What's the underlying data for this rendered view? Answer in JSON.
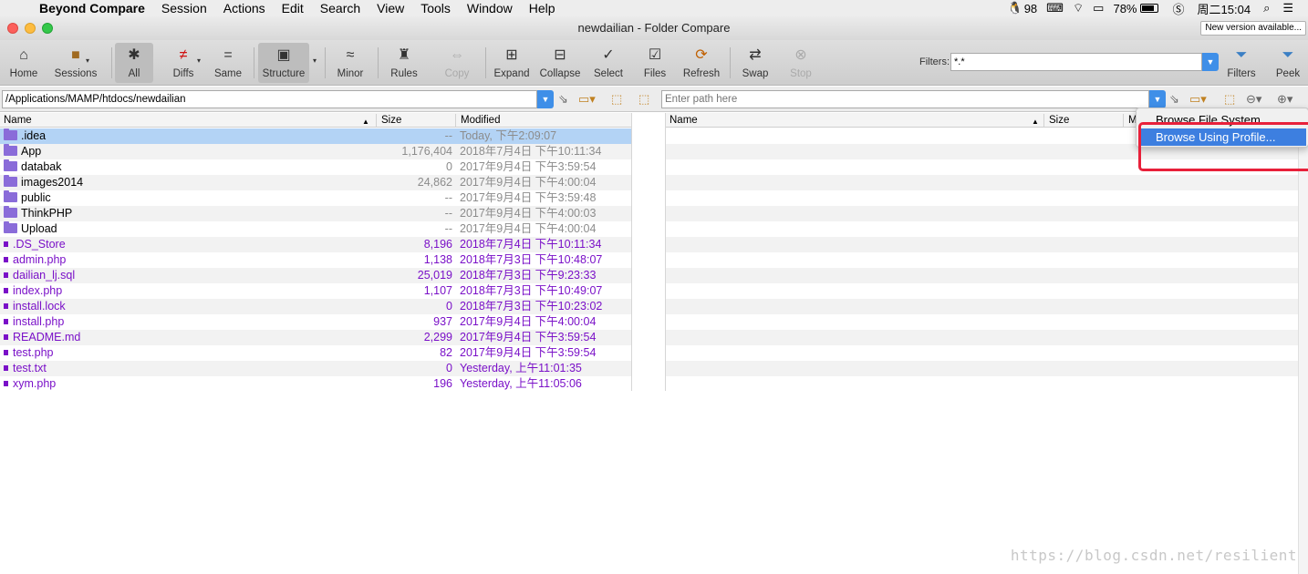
{
  "menubar": {
    "app_name": "Beyond Compare",
    "items": [
      "Session",
      "Actions",
      "Edit",
      "Search",
      "View",
      "Tools",
      "Window",
      "Help"
    ],
    "status": {
      "qq_count": "98",
      "battery": "78%",
      "clock": "周二15:04"
    }
  },
  "window": {
    "title": "newdailian - Folder Compare",
    "new_version": "New version available..."
  },
  "toolbar": {
    "home": "Home",
    "sessions": "Sessions",
    "all": "All",
    "diffs": "Diffs",
    "same": "Same",
    "structure": "Structure",
    "minor": "Minor",
    "rules": "Rules",
    "copy": "Copy",
    "expand": "Expand",
    "collapse": "Collapse",
    "select": "Select",
    "files": "Files",
    "refresh": "Refresh",
    "swap": "Swap",
    "stop": "Stop",
    "filters": "Filters",
    "peek": "Peek",
    "filters_label": "Filters:",
    "filters_value": "*.*"
  },
  "paths": {
    "left": "/Applications/MAMP/htdocs/newdailian",
    "right_placeholder": "Enter path here"
  },
  "columns": {
    "left": {
      "name": "Name",
      "size": "Size",
      "modified": "Modified"
    },
    "right": {
      "name": "Name",
      "size": "Size",
      "modified": "M"
    }
  },
  "left_files": [
    {
      "name": ".idea",
      "type": "folder",
      "size": "--",
      "modified": "Today, 下午2:09:07",
      "selected": true
    },
    {
      "name": "App",
      "type": "folder",
      "size": "1,176,404",
      "modified": "2018年7月4日 下午10:11:34"
    },
    {
      "name": "databak",
      "type": "folder",
      "size": "0",
      "modified": "2017年9月4日 下午3:59:54"
    },
    {
      "name": "images2014",
      "type": "folder",
      "size": "24,862",
      "modified": "2017年9月4日 下午4:00:04"
    },
    {
      "name": "public",
      "type": "folder",
      "size": "--",
      "modified": "2017年9月4日 下午3:59:48"
    },
    {
      "name": "ThinkPHP",
      "type": "folder",
      "size": "--",
      "modified": "2017年9月4日 下午4:00:03"
    },
    {
      "name": "Upload",
      "type": "folder",
      "size": "--",
      "modified": "2017年9月4日 下午4:00:04"
    },
    {
      "name": ".DS_Store",
      "type": "file",
      "size": "8,196",
      "modified": "2018年7月4日 下午10:11:34"
    },
    {
      "name": "admin.php",
      "type": "file",
      "size": "1,138",
      "modified": "2018年7月3日 下午10:48:07"
    },
    {
      "name": "dailian_lj.sql",
      "type": "file",
      "size": "25,019",
      "modified": "2018年7月3日 下午9:23:33"
    },
    {
      "name": "index.php",
      "type": "file",
      "size": "1,107",
      "modified": "2018年7月3日 下午10:49:07"
    },
    {
      "name": "install.lock",
      "type": "file",
      "size": "0",
      "modified": "2018年7月3日 下午10:23:02"
    },
    {
      "name": "install.php",
      "type": "file",
      "size": "937",
      "modified": "2017年9月4日 下午4:00:04"
    },
    {
      "name": "README.md",
      "type": "file",
      "size": "2,299",
      "modified": "2017年9月4日 下午3:59:54"
    },
    {
      "name": "test.php",
      "type": "file",
      "size": "82",
      "modified": "2017年9月4日 下午3:59:54"
    },
    {
      "name": "test.txt",
      "type": "file",
      "size": "0",
      "modified": "Yesterday, 上午11:01:35"
    },
    {
      "name": "xym.php",
      "type": "file",
      "size": "196",
      "modified": "Yesterday, 上午11:05:06"
    }
  ],
  "dropdown_menu": [
    "Browse File System...",
    "Browse Using Profile..."
  ],
  "watermark": "https://blog.csdn.net/resilient",
  "colors": {
    "accent": "#3d7fe0",
    "selection": "#b3d3f5",
    "file_text": "#7a10c8",
    "highlight": "#e8203a"
  }
}
